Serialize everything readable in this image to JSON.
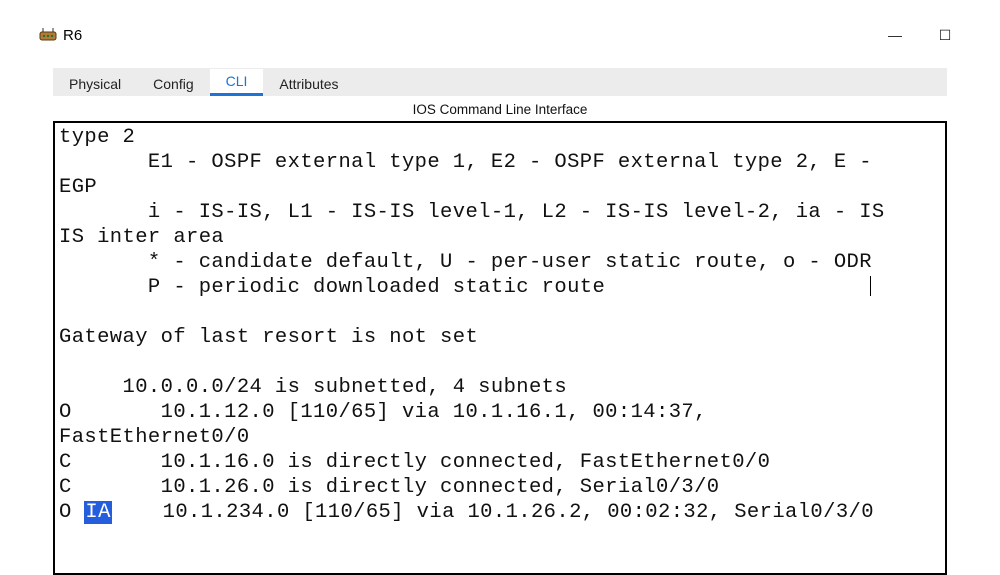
{
  "window": {
    "title": "R6",
    "controls": {
      "minimize": "—",
      "maximize": "☐"
    }
  },
  "tabs": {
    "items": [
      {
        "label": "Physical",
        "active": false
      },
      {
        "label": "Config",
        "active": false
      },
      {
        "label": "CLI",
        "active": true
      },
      {
        "label": "Attributes",
        "active": false
      }
    ]
  },
  "cli": {
    "panel_title": "IOS Command Line Interface",
    "lines": {
      "l0": "type 2",
      "l1": "       E1 - OSPF external type 1, E2 - OSPF external type 2, E -",
      "l2": "EGP",
      "l3": "       i - IS-IS, L1 - IS-IS level-1, L2 - IS-IS level-2, ia - IS",
      "l4": "IS inter area",
      "l5": "       * - candidate default, U - per-user static route, o - ODR",
      "l6": "       P - periodic downloaded static route",
      "l7": "",
      "l8": "Gateway of last resort is not set",
      "l9": "",
      "l10": "     10.0.0.0/24 is subnetted, 4 subnets",
      "l11": "O       10.1.12.0 [110/65] via 10.1.16.1, 00:14:37,",
      "l12": "FastEthernet0/0",
      "l13": "C       10.1.16.0 is directly connected, FastEthernet0/0",
      "l14": "C       10.1.26.0 is directly connected, Serial0/3/0",
      "l15a": "O ",
      "l15hl": "IA",
      "l15b": "    10.1.234.0 [110/65] via 10.1.26.2, 00:02:32, Serial0/3/0"
    }
  }
}
